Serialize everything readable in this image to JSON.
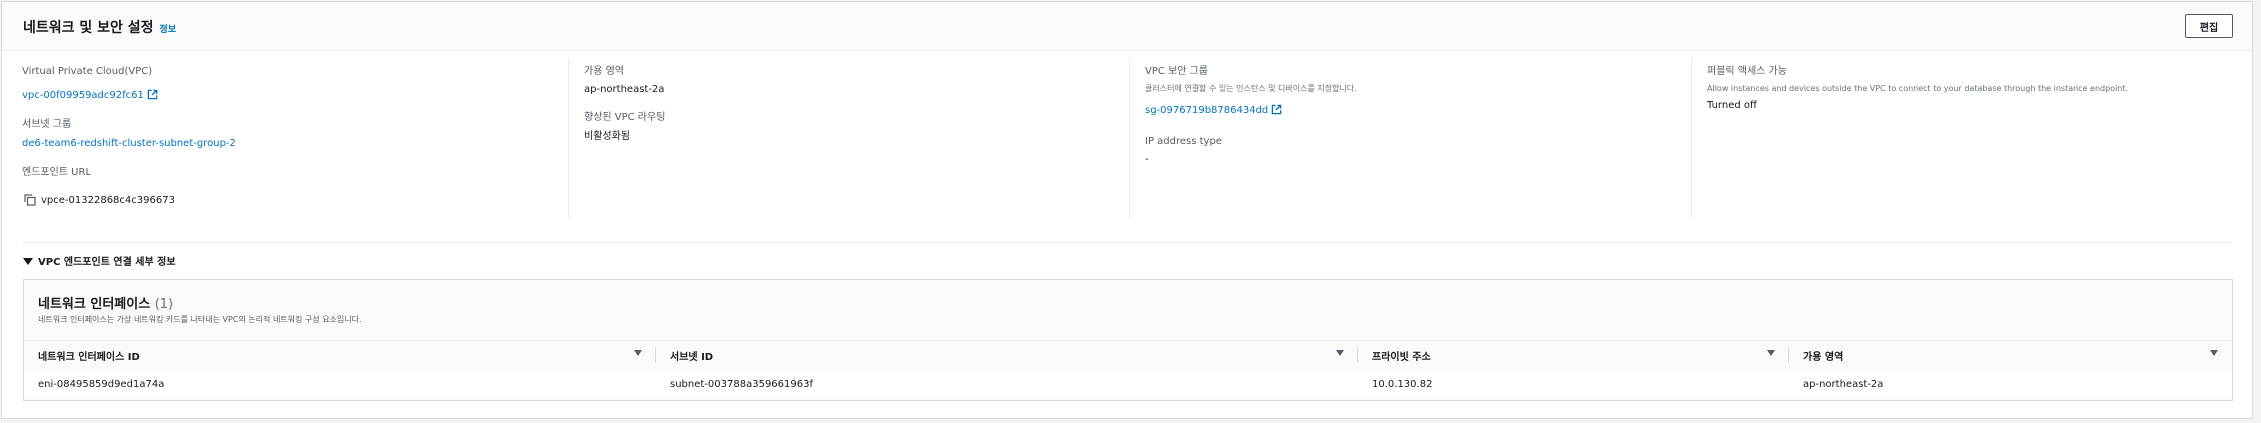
{
  "section": {
    "title": "네트워크 및 보안 설정",
    "info_label": "정보",
    "edit_label": "편집"
  },
  "columns": {
    "vpc": {
      "label": "Virtual Private Cloud(VPC)",
      "value": "vpc-00f09959adc92fc61"
    },
    "subnet_group": {
      "label": "서브넷 그룹",
      "value": "de6-team6-redshift-cluster-subnet-group-2"
    },
    "endpoint_url": {
      "label": "엔드포인트 URL",
      "value": "vpce-01322868c4c396673"
    },
    "az": {
      "label": "가용 영역",
      "value": "ap-northeast-2a"
    },
    "enhanced_vpc": {
      "label": "향상된 VPC 라우팅",
      "value": "비활성화됨"
    },
    "security_group": {
      "label": "VPC 보안 그룹",
      "description": "클러스터에 연결할 수 있는 인스턴스 및 디바이스를 지정합니다.",
      "value": "sg-0976719b8786434dd"
    },
    "ip_type": {
      "label": "IP address type",
      "value": "-"
    },
    "public_access": {
      "label": "퍼블릭 액세스 가능",
      "description": "Allow instances and devices outside the VPC to connect to your database through the instance endpoint.",
      "value": "Turned off"
    }
  },
  "expander": {
    "label": "VPC 엔드포인트 연결 세부 정보"
  },
  "network_interfaces": {
    "title": "네트워크 인터페이스",
    "count": "(1)",
    "description": "네트워크 인터페이스는 가상 네트워킹 카드를 나타내는 VPC의 논리적 네트워킹 구성 요소입니다.",
    "headers": [
      "네트워크 인터페이스 ID",
      "서브넷 ID",
      "프라이빗 주소",
      "가용 영역"
    ],
    "rows": [
      [
        "eni-08495859d9ed1a74a",
        "subnet-003788a359661963f",
        "10.0.130.82",
        "ap-northeast-2a"
      ]
    ]
  },
  "colors": {
    "link": "#0073bb",
    "text": "#16191f",
    "muted": "#545b64"
  },
  "icons": {
    "external": "external-link-icon",
    "copy": "copy-icon",
    "caret": "caret-down-icon",
    "sort": "sort-icon"
  }
}
